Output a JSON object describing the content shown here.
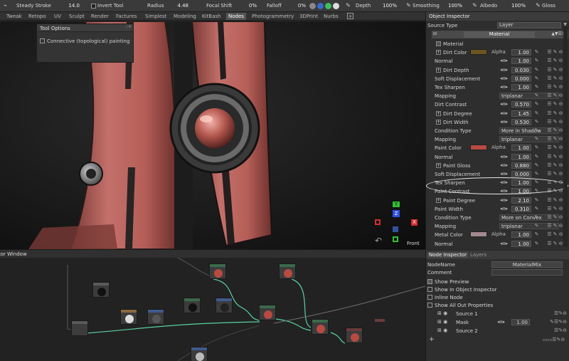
{
  "toolbar": {
    "steady_stroke_label": "Steady Stroke",
    "steady_stroke_value": "14.0",
    "invert_tool_label": "Invert Tool",
    "radius_label": "Radius",
    "radius_value": "4.48",
    "focal_shift_label": "Focal Shift",
    "focal_shift_value": "0%",
    "falloff_label": "Falloff",
    "falloff_value": "0%",
    "depth_label": "Depth",
    "depth_value": "100%",
    "smoothing_label": "Smoothing",
    "smoothing_value": "100%",
    "albedo_label": "Albedo",
    "albedo_value": "100%",
    "gloss_label": "Gloss"
  },
  "tabs": [
    "Tweak",
    "Retopo",
    "UV",
    "Sculpt",
    "Render",
    "Factures",
    "Simplest",
    "Modeling",
    "KitBash",
    "Nodes",
    "Photogrammetry",
    "3DPrint",
    "Nurbs"
  ],
  "tool_options": {
    "title": "Tool Options",
    "connective_label": "Connective (topological) painting"
  },
  "viewport": {
    "gizmo_y": "Y",
    "gizmo_z": "Z",
    "gizmo_x": "X",
    "view_label": "Front"
  },
  "node_editor": {
    "title": "itor Window"
  },
  "object_inspector": {
    "title": "Object Inspector",
    "source_type_label": "Source Type",
    "source_type_value": "Layer",
    "material_name": "Material",
    "rows": [
      {
        "label": "Material",
        "kind": "check"
      },
      {
        "label": "Dirt Color",
        "kind": "color",
        "color": "#6b5520",
        "alpha": "Alpha",
        "value": "1.00"
      },
      {
        "label": "Normal",
        "kind": "num",
        "value": "1.00"
      },
      {
        "label": "Dirt Depth",
        "kind": "num",
        "value": "0.030"
      },
      {
        "label": "Soft Displacement",
        "kind": "num",
        "value": "0.000"
      },
      {
        "label": "Tex Sharpen",
        "kind": "num",
        "value": "1.00"
      },
      {
        "label": "Mapping",
        "kind": "text",
        "value": "triplanar"
      },
      {
        "label": "Dirt Contrast",
        "kind": "num",
        "value": "0.570"
      },
      {
        "label": "Dirt Degree",
        "kind": "num",
        "value": "1.45"
      },
      {
        "label": "Dirt Width",
        "kind": "num",
        "value": "0.530"
      },
      {
        "label": "Condition Type",
        "kind": "text",
        "value": "More in Shadow"
      },
      {
        "label": "Mapping",
        "kind": "text",
        "value": "triplanar"
      },
      {
        "label": "Paint Color",
        "kind": "color",
        "color": "#b84a40",
        "alpha": "Alpha",
        "value": "1.00"
      },
      {
        "label": "Normal",
        "kind": "num",
        "value": "1.00"
      },
      {
        "label": "Paint Gloss",
        "kind": "num",
        "value": "0.880"
      },
      {
        "label": "Soft Displacement",
        "kind": "num",
        "value": "0.000"
      },
      {
        "label": "Tex Sharpen",
        "kind": "num",
        "value": "1.00"
      },
      {
        "label": "Paint Contrast",
        "kind": "num",
        "value": "1.00"
      },
      {
        "label": "Paint Degree",
        "kind": "num",
        "value": "2.10"
      },
      {
        "label": "Paint Width",
        "kind": "num",
        "value": "0.310"
      },
      {
        "label": "Condition Type",
        "kind": "text",
        "value": "More on Convex"
      },
      {
        "label": "Mapping",
        "kind": "text",
        "value": "triplanar"
      },
      {
        "label": "Metal Color",
        "kind": "color",
        "color": "#a08a8e",
        "alpha": "Alpha",
        "value": "1.00"
      },
      {
        "label": "Normal",
        "kind": "num",
        "value": "1.00"
      }
    ]
  },
  "node_inspector": {
    "tab_label": "Node Inspector",
    "layers_tab": "Layers",
    "nodename_label": "NodeName",
    "nodename_value": "MaterialMix",
    "comment_label": "Comment",
    "show_preview": "Show Preview",
    "show_in_oi": "Show In Object Inspector",
    "inline_node": "Inline Node",
    "show_all_out": "Show All Out Properties",
    "source1": "Source 1",
    "mask": "Mask",
    "mask_value": "1.00",
    "source2": "Source 2"
  },
  "colors": {
    "accent_green": "#3cc060",
    "gizmo_red": "#d03030",
    "gizmo_green": "#30c030",
    "gizmo_blue": "#3050e0",
    "panel_bg": "#2e2e2e",
    "paint_red": "#b84a40",
    "node_link": "#5ad0a0"
  }
}
